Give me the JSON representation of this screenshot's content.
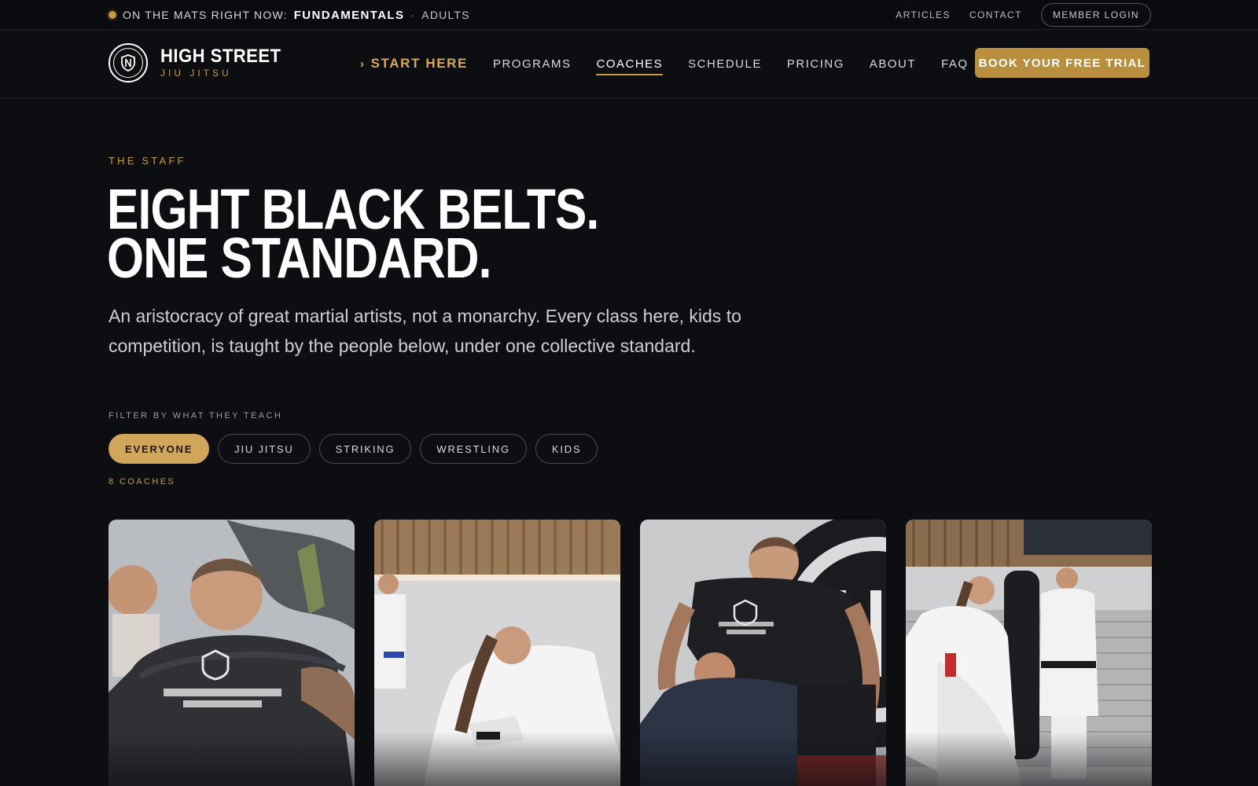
{
  "topbar": {
    "now_prefix": "ON THE MATS RIGHT NOW:",
    "now_class": "FUNDAMENTALS",
    "now_sep": "·",
    "now_group": "ADULTS",
    "links": [
      "ARTICLES",
      "CONTACT"
    ],
    "member_login": "MEMBER LOGIN"
  },
  "brand": {
    "name": "HIGH STREET",
    "sub": "JIU JITSU"
  },
  "nav": {
    "start_here": "START HERE",
    "items": [
      "PROGRAMS",
      "COACHES",
      "SCHEDULE",
      "PRICING",
      "ABOUT",
      "FAQ"
    ],
    "active": "COACHES",
    "cta": "BOOK YOUR FREE TRIAL"
  },
  "hero": {
    "eyebrow": "THE STAFF",
    "title_line1": "EIGHT BLACK BELTS.",
    "title_line2": "ONE STANDARD.",
    "lede": "An aristocracy of great martial artists, not a monarchy. Every class here, kids to competition, is taught by the people below, under one collective standard."
  },
  "filter": {
    "label": "FILTER BY WHAT THEY TEACH",
    "chips": [
      "EVERYONE",
      "JIU JITSU",
      "STRIKING",
      "WRESTLING",
      "KIDS"
    ],
    "active": "EVERYONE",
    "count": "8 COACHES"
  },
  "colors": {
    "background": "#0d0e11",
    "accent_gold": "#c79a42",
    "cta_gold": "#b98f3e",
    "chip_active": "#d1a55a"
  },
  "icons": {
    "live": "live-dot-icon",
    "start_chevron": "chevron-right-icon",
    "logo": "shield-logo-icon"
  }
}
